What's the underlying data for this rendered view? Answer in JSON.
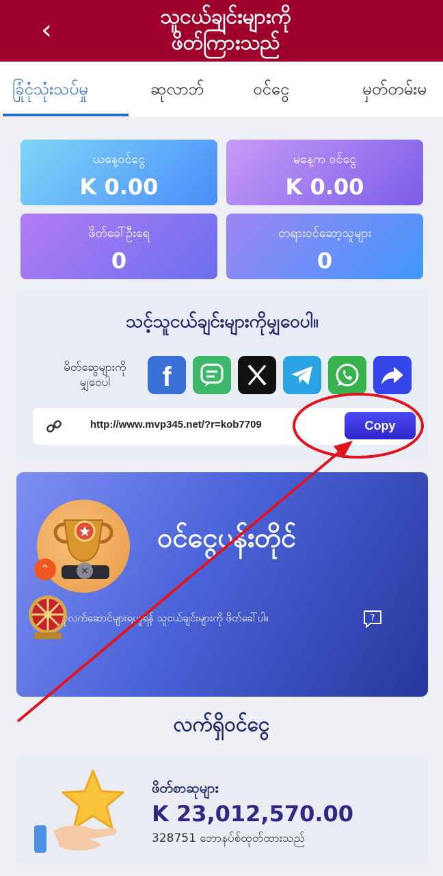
{
  "header": {
    "back_icon": "chevron-left-icon",
    "title_line1": "သူငယ်ချင်းများကို",
    "title_line2": "ဖိတ်ကြားသည်"
  },
  "tabs": [
    {
      "label": "ခြုံငုံသုံးသပ်မှု",
      "active": true
    },
    {
      "label": "ဆုလာဘ်",
      "active": false
    },
    {
      "label": "ဝင်ငွေ",
      "active": false
    },
    {
      "label": "မှတ်တမ်းမ",
      "active": false
    }
  ],
  "stats": [
    {
      "label": "ယနေ့ဝင်ငွေ",
      "value": "K 0.00"
    },
    {
      "label": "မနေ့က ဝင်ငွေ",
      "value": "K 0.00"
    },
    {
      "label": "ဖိတ်ခေါ်ဦးရေ",
      "value": "0"
    },
    {
      "label": "တရားဝင်ဆော့သူများ",
      "value": "0"
    }
  ],
  "invite": {
    "title": "သင့်သူငယ်ချင်းများကိုမျှဝေပါ။",
    "share_label_line1": "မိတ်ဆွေများကို",
    "share_label_line2": "မျှဝေပါ",
    "share_icons": [
      "facebook-icon",
      "message-icon",
      "x-icon",
      "telegram-icon",
      "whatsapp-icon",
      "share-arrow-icon"
    ],
    "link": "http://www.mvp345.net/?r=kob7709",
    "copy_label": "Copy"
  },
  "prize": {
    "title": "ဝင်ငွေပန်းတိုင်",
    "description": "ုလက်ဆောင်များရယူရန် သူငယ်ချင်းများကို ဖိတ်ခေါ်ပါ။"
  },
  "current": {
    "title": "လက်ရှိဝင်ငွေ"
  },
  "rewards": {
    "label": "ဖိတ်စာဆုများ",
    "value": "K 23,012,570.00",
    "sub": "328751 ဘောနပ်စ်ထုတ်ထားသည်"
  },
  "colors": {
    "header": "#a0002c",
    "accent": "#2a6fc4",
    "copy_button": "#3b35e0",
    "annotation": "#e0141e"
  }
}
